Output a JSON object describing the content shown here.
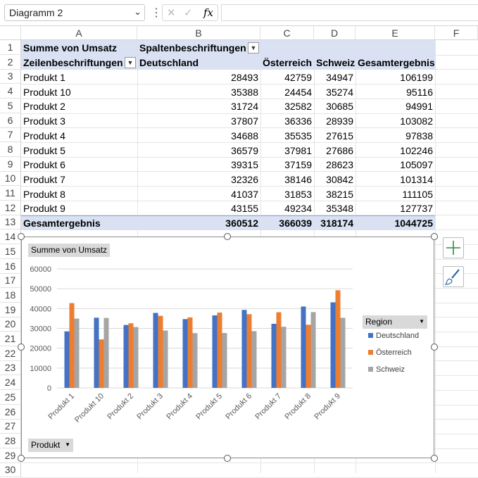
{
  "namebox": {
    "value": "Diagramm 2",
    "fx": "fx"
  },
  "columns": [
    "A",
    "B",
    "C",
    "D",
    "E",
    "F"
  ],
  "rows": [
    "1",
    "2",
    "3",
    "4",
    "5",
    "6",
    "7",
    "8",
    "9",
    "10",
    "11",
    "12",
    "13",
    "14",
    "15",
    "16",
    "17",
    "18",
    "19",
    "20",
    "21",
    "22",
    "23",
    "24",
    "25",
    "26",
    "27",
    "28",
    "29",
    "30"
  ],
  "pivot": {
    "r1a": "Summe von Umsatz",
    "r1b": "Spaltenbeschriftungen",
    "r2a": "Zeilenbeschriftungen",
    "r2b": "Deutschland",
    "r2c": "Österreich",
    "r2d": "Schweiz",
    "r2e": "Gesamtergebnis",
    "rows": [
      {
        "label": "Produkt 1",
        "de": "28493",
        "at": "42759",
        "ch": "34947",
        "total": "106199"
      },
      {
        "label": "Produkt 10",
        "de": "35388",
        "at": "24454",
        "ch": "35274",
        "total": "95116"
      },
      {
        "label": "Produkt 2",
        "de": "31724",
        "at": "32582",
        "ch": "30685",
        "total": "94991"
      },
      {
        "label": "Produkt 3",
        "de": "37807",
        "at": "36336",
        "ch": "28939",
        "total": "103082"
      },
      {
        "label": "Produkt 4",
        "de": "34688",
        "at": "35535",
        "ch": "27615",
        "total": "97838"
      },
      {
        "label": "Produkt 5",
        "de": "36579",
        "at": "37981",
        "ch": "27686",
        "total": "102246"
      },
      {
        "label": "Produkt 6",
        "de": "39315",
        "at": "37159",
        "ch": "28623",
        "total": "105097"
      },
      {
        "label": "Produkt 7",
        "de": "32326",
        "at": "38146",
        "ch": "30842",
        "total": "101314"
      },
      {
        "label": "Produkt 8",
        "de": "41037",
        "at": "31853",
        "ch": "38215",
        "total": "111105"
      },
      {
        "label": "Produkt 9",
        "de": "43155",
        "at": "49234",
        "ch": "35348",
        "total": "127737"
      }
    ],
    "total": {
      "label": "Gesamtergebnis",
      "de": "360512",
      "at": "366039",
      "ch": "318174",
      "total": "1044725"
    }
  },
  "chart_buttons": {
    "value_field": "Summe von Umsatz",
    "axis_field": "Produkt",
    "legend_field": "Region"
  },
  "chart_data": {
    "type": "bar",
    "categories": [
      "Produkt 1",
      "Produkt 10",
      "Produkt 2",
      "Produkt 3",
      "Produkt 4",
      "Produkt 5",
      "Produkt 6",
      "Produkt 7",
      "Produkt 8",
      "Produkt 9"
    ],
    "series": [
      {
        "name": "Deutschland",
        "color": "#4472c4",
        "values": [
          28493,
          35388,
          31724,
          37807,
          34688,
          36579,
          39315,
          32326,
          41037,
          43155
        ]
      },
      {
        "name": "Österreich",
        "color": "#ed7d31",
        "values": [
          42759,
          24454,
          32582,
          36336,
          35535,
          37981,
          37159,
          38146,
          31853,
          49234
        ]
      },
      {
        "name": "Schweiz",
        "color": "#a5a5a5",
        "values": [
          34947,
          35274,
          30685,
          28939,
          27615,
          27686,
          28623,
          30842,
          38215,
          35348
        ]
      }
    ],
    "yticks": [
      "0",
      "10000",
      "20000",
      "30000",
      "40000",
      "50000",
      "60000"
    ],
    "ylim": [
      0,
      60000
    ],
    "grid": true,
    "legend": "right"
  }
}
